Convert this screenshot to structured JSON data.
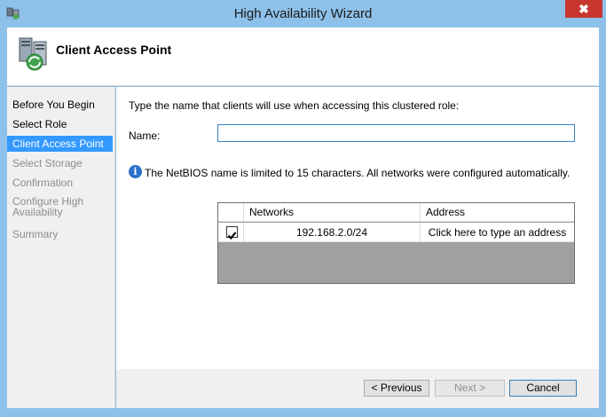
{
  "window": {
    "title": "High Availability Wizard",
    "close_glyph": "✖"
  },
  "header": {
    "title": "Client Access Point"
  },
  "nav": {
    "items": [
      {
        "label": "Before You Begin",
        "state": "normal"
      },
      {
        "label": "Select Role",
        "state": "normal"
      },
      {
        "label": "Client Access Point",
        "state": "selected"
      },
      {
        "label": "Select Storage",
        "state": "disabled"
      },
      {
        "label": "Confirmation",
        "state": "disabled"
      },
      {
        "label_line1": "Configure High",
        "label_line2": "Availability",
        "state": "disabled"
      },
      {
        "label": "Summary",
        "state": "disabled"
      }
    ]
  },
  "content": {
    "instruction": "Type the name that clients will use when accessing this clustered role:",
    "name_label": "Name:",
    "name_value": "",
    "info_glyph": "i",
    "info_text": "The NetBIOS name is limited to 15 characters.  All networks were configured automatically."
  },
  "networks_grid": {
    "columns": [
      "Networks",
      "Address"
    ],
    "rows": [
      {
        "checked": true,
        "network": "192.168.2.0/24",
        "address": "Click here to type an address"
      }
    ]
  },
  "footer": {
    "previous_label": "< Previous",
    "next_label": "Next >",
    "cancel_label": "Cancel"
  },
  "colors": {
    "titlebar": "#8ec1ea",
    "selection": "#3399ff",
    "close": "#c7372f"
  }
}
